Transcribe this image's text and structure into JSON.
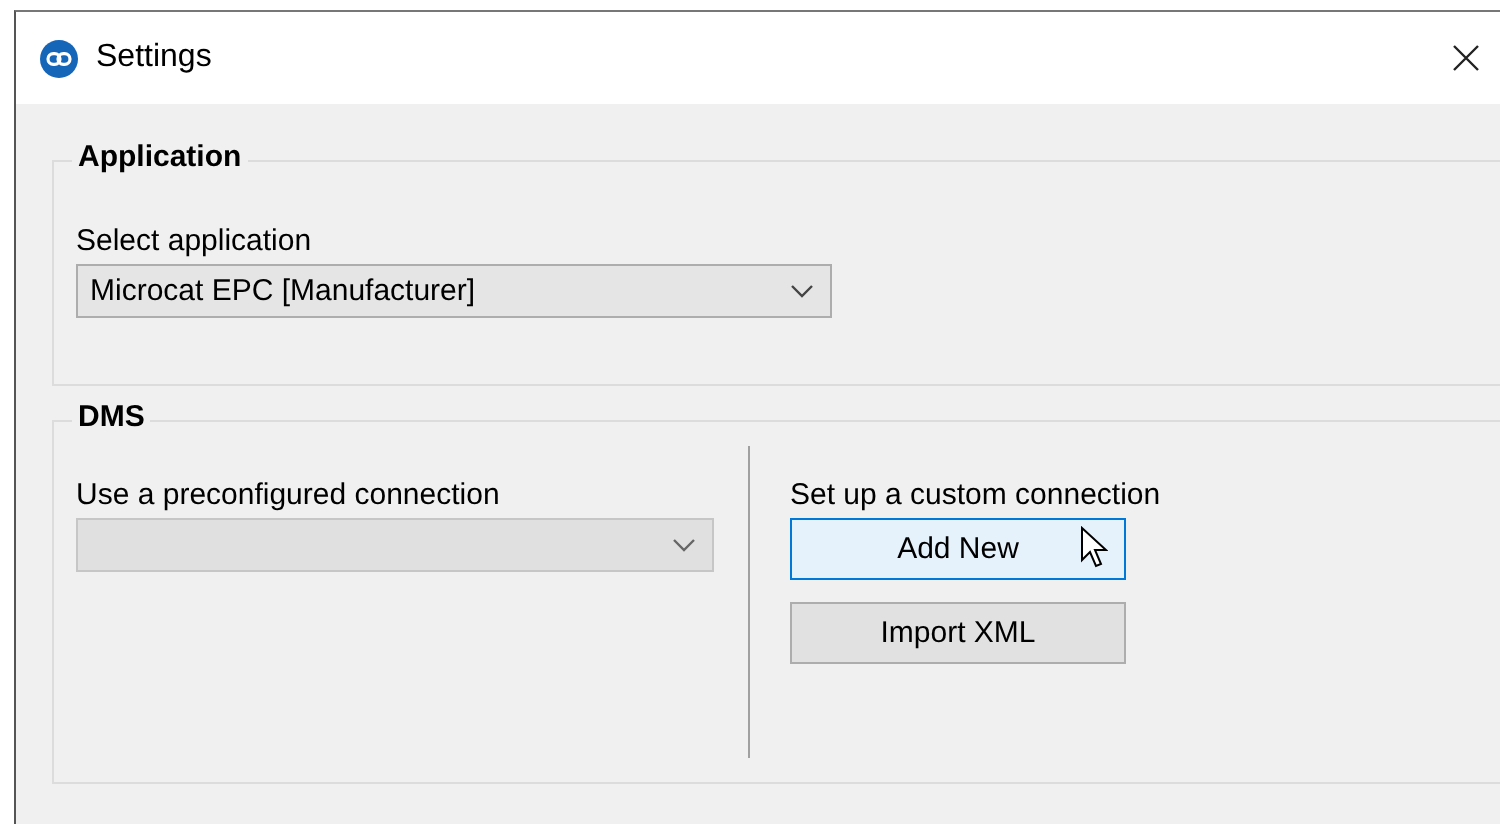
{
  "window": {
    "title": "Settings"
  },
  "application": {
    "legend": "Application",
    "label": "Select application",
    "dropdown": {
      "value": "Microcat EPC [Manufacturer]",
      "disabled": false
    }
  },
  "dms": {
    "legend": "DMS",
    "preconfigured": {
      "label": "Use a preconfigured connection",
      "dropdown": {
        "disabled": true
      }
    },
    "custom": {
      "label": "Set up a custom connection",
      "buttons": [
        {
          "label": "Add New",
          "hovered": true
        },
        {
          "label": "Import XML",
          "hovered": false
        }
      ]
    }
  },
  "cursor": {
    "visible": true
  }
}
